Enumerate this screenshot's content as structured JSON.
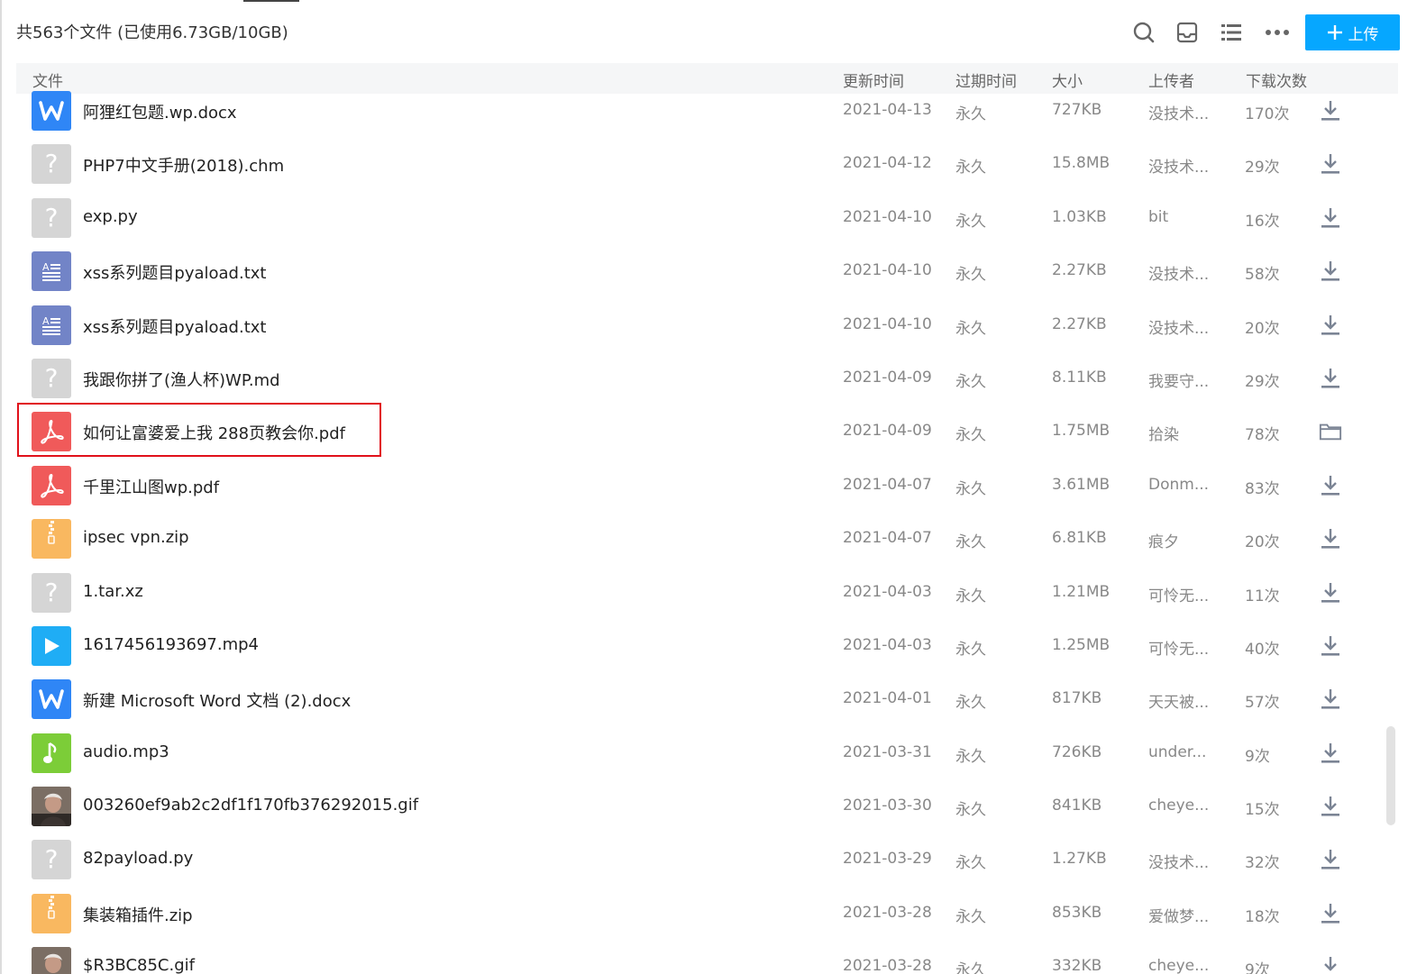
{
  "header": {
    "summary": "共563个文件 (已使用6.73GB/10GB)",
    "upload_label": "上传"
  },
  "columns": {
    "file": "文件",
    "updated": "更新时间",
    "expires": "过期时间",
    "size": "大小",
    "uploader": "上传者",
    "downloads": "下载次数"
  },
  "colors": {
    "accent": "#06a7ff",
    "highlight_border": "#e1111a"
  },
  "files": [
    {
      "name": "阿狸红包题.wp.docx",
      "updated": "2021-04-13",
      "expires": "永久",
      "size": "727KB",
      "uploader": "没技术...",
      "downloads": "170次",
      "type": "word",
      "action": "download"
    },
    {
      "name": "PHP7中文手册(2018).chm",
      "updated": "2021-04-12",
      "expires": "永久",
      "size": "15.8MB",
      "uploader": "没技术...",
      "downloads": "29次",
      "type": "unknown",
      "action": "download"
    },
    {
      "name": "exp.py",
      "updated": "2021-04-10",
      "expires": "永久",
      "size": "1.03KB",
      "uploader": "bit",
      "downloads": "16次",
      "type": "unknown",
      "action": "download"
    },
    {
      "name": "xss系列题目pyaload.txt",
      "updated": "2021-04-10",
      "expires": "永久",
      "size": "2.27KB",
      "uploader": "没技术...",
      "downloads": "58次",
      "type": "text",
      "action": "download"
    },
    {
      "name": "xss系列题目pyaload.txt",
      "updated": "2021-04-10",
      "expires": "永久",
      "size": "2.27KB",
      "uploader": "没技术...",
      "downloads": "20次",
      "type": "text",
      "action": "download"
    },
    {
      "name": "我跟你拼了(渔人杯)WP.md",
      "updated": "2021-04-09",
      "expires": "永久",
      "size": "8.11KB",
      "uploader": "我要守...",
      "downloads": "29次",
      "type": "unknown",
      "action": "download"
    },
    {
      "name": "如何让富婆爱上我 288页教会你.pdf",
      "updated": "2021-04-09",
      "expires": "永久",
      "size": "1.75MB",
      "uploader": "拾染",
      "downloads": "78次",
      "type": "pdf",
      "action": "folder"
    },
    {
      "name": "千里江山图wp.pdf",
      "updated": "2021-04-07",
      "expires": "永久",
      "size": "3.61MB",
      "uploader": "Donm...",
      "downloads": "83次",
      "type": "pdf",
      "action": "download"
    },
    {
      "name": "ipsec vpn.zip",
      "updated": "2021-04-07",
      "expires": "永久",
      "size": "6.81KB",
      "uploader": "痕夕",
      "downloads": "20次",
      "type": "zip",
      "action": "download"
    },
    {
      "name": "1.tar.xz",
      "updated": "2021-04-03",
      "expires": "永久",
      "size": "1.21MB",
      "uploader": "可怜无...",
      "downloads": "11次",
      "type": "unknown",
      "action": "download"
    },
    {
      "name": "1617456193697.mp4",
      "updated": "2021-04-03",
      "expires": "永久",
      "size": "1.25MB",
      "uploader": "可怜无...",
      "downloads": "40次",
      "type": "video",
      "action": "download"
    },
    {
      "name": "新建 Microsoft Word 文档 (2).docx",
      "updated": "2021-04-01",
      "expires": "永久",
      "size": "817KB",
      "uploader": "天天被...",
      "downloads": "57次",
      "type": "word",
      "action": "download"
    },
    {
      "name": "audio.mp3",
      "updated": "2021-03-31",
      "expires": "永久",
      "size": "726KB",
      "uploader": "under...",
      "downloads": "9次",
      "type": "audio",
      "action": "download"
    },
    {
      "name": "003260ef9ab2c2df1f170fb376292015.gif",
      "updated": "2021-03-30",
      "expires": "永久",
      "size": "841KB",
      "uploader": "cheye...",
      "downloads": "15次",
      "type": "image",
      "action": "download"
    },
    {
      "name": "82payload.py",
      "updated": "2021-03-29",
      "expires": "永久",
      "size": "1.27KB",
      "uploader": "没技术...",
      "downloads": "32次",
      "type": "unknown",
      "action": "download"
    },
    {
      "name": "集装箱插件.zip",
      "updated": "2021-03-28",
      "expires": "永久",
      "size": "853KB",
      "uploader": "爱做梦...",
      "downloads": "18次",
      "type": "zip",
      "action": "download"
    },
    {
      "name": "$R3BC85C.gif",
      "updated": "2021-03-28",
      "expires": "永久",
      "size": "332KB",
      "uploader": "cheye...",
      "downloads": "9次",
      "type": "image",
      "action": "download"
    }
  ]
}
